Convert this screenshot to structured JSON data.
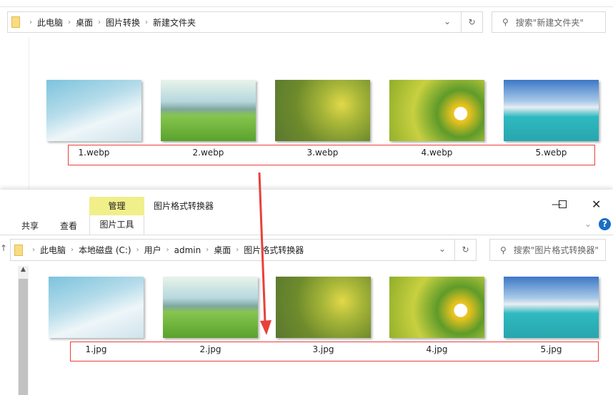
{
  "top_window": {
    "breadcrumb": [
      "此电脑",
      "桌面",
      "图片转换",
      "新建文件夹"
    ],
    "search_placeholder": "搜索\"新建文件夹\"",
    "files": [
      "1.webp",
      "2.webp",
      "3.webp",
      "4.webp",
      "5.webp"
    ]
  },
  "bottom_window": {
    "context_tab": "管理",
    "context_tab_color": "#f0ef8a",
    "title": "图片格式转换器",
    "ribbon_tabs": [
      "共享",
      "查看",
      "图片工具"
    ],
    "breadcrumb": [
      "此电脑",
      "本地磁盘 (C:)",
      "用户",
      "admin",
      "桌面",
      "图片格式转换器"
    ],
    "search_placeholder": "搜索\"图片格式转换器\"",
    "files": [
      "1.jpg",
      "2.jpg",
      "3.jpg",
      "4.jpg",
      "5.jpg"
    ]
  },
  "annotation_color": "#e8413a"
}
